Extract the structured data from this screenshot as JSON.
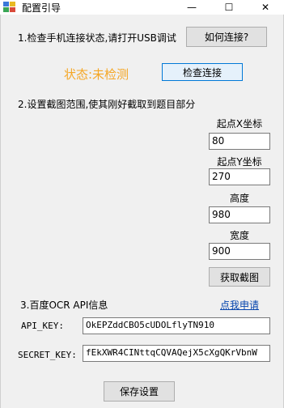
{
  "window": {
    "title": "配置引导",
    "minimize_glyph": "—",
    "maximize_glyph": "☐",
    "close_glyph": "✕"
  },
  "step1": {
    "label": "1.检查手机连接状态,请打开USB调试",
    "how_connect_button": "如何连接?",
    "status_text": "状态:未检测",
    "check_button": "检查连接"
  },
  "step2": {
    "label": "2.设置截图范围,使其刚好截取到题目部分",
    "start_x_label": "起点X坐标",
    "start_x_value": "80",
    "start_y_label": "起点Y坐标",
    "start_y_value": "270",
    "height_label": "高度",
    "height_value": "980",
    "width_label": "宽度",
    "width_value": "900",
    "capture_button": "获取截图"
  },
  "step3": {
    "label": "3.百度OCR API信息",
    "apply_link": "点我申请",
    "api_key_label": "API_KEY:",
    "api_key_value": "OkEPZddCBO5cUDOLflyTN910",
    "secret_key_label": "SECRET_KEY:",
    "secret_key_value": "fEkXWR4CINttqCQVAQejX5cXgQKrVbnW"
  },
  "save_button": "保存设置",
  "colors": {
    "status": "#f5a623",
    "link": "#0645ad",
    "primary_border": "#0078d7"
  }
}
